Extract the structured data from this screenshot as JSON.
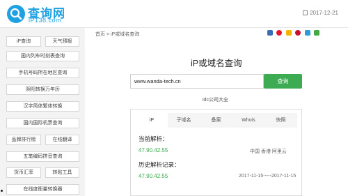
{
  "header": {
    "site_name": "查询网",
    "site_domain": "iP138.com",
    "date": "2017-12-21"
  },
  "sidebar": {
    "rows": [
      [
        "iP查询",
        "天气预报"
      ],
      [
        "国内列车时刻表查询"
      ],
      [
        "手机号码所在地区查询"
      ],
      [
        "阴阳转换万年历"
      ],
      [
        "汉字简体繁体转换"
      ],
      [
        "国内国际机票查询"
      ],
      [
        "品牌排行榜",
        "在线翻译"
      ],
      [
        "五笔编码拼音查询"
      ],
      [
        "货币汇率",
        "转贴工具"
      ],
      [
        "在线度衡量转换器"
      ]
    ]
  },
  "breadcrumb": "首页 > iP或域名查询",
  "main": {
    "title": "iP或域名查询",
    "search_value": "www.wanda-tech.cn",
    "search_button": "查询",
    "idc_link": "idc公司大全",
    "tabs": [
      "iP",
      "子域名",
      "备案",
      "Whois",
      "快照"
    ],
    "current_label": "当前解析：",
    "current_ip": "47.90.42.55",
    "current_location": "中国 香港 阿里云",
    "history_label": "历史解析记录：",
    "history_ip": "47.90.42.55",
    "history_range": "2017-11-15-----2017-11-15"
  },
  "colors": {
    "brand_blue": "#1da1e2",
    "accent_green": "#3cab52"
  }
}
